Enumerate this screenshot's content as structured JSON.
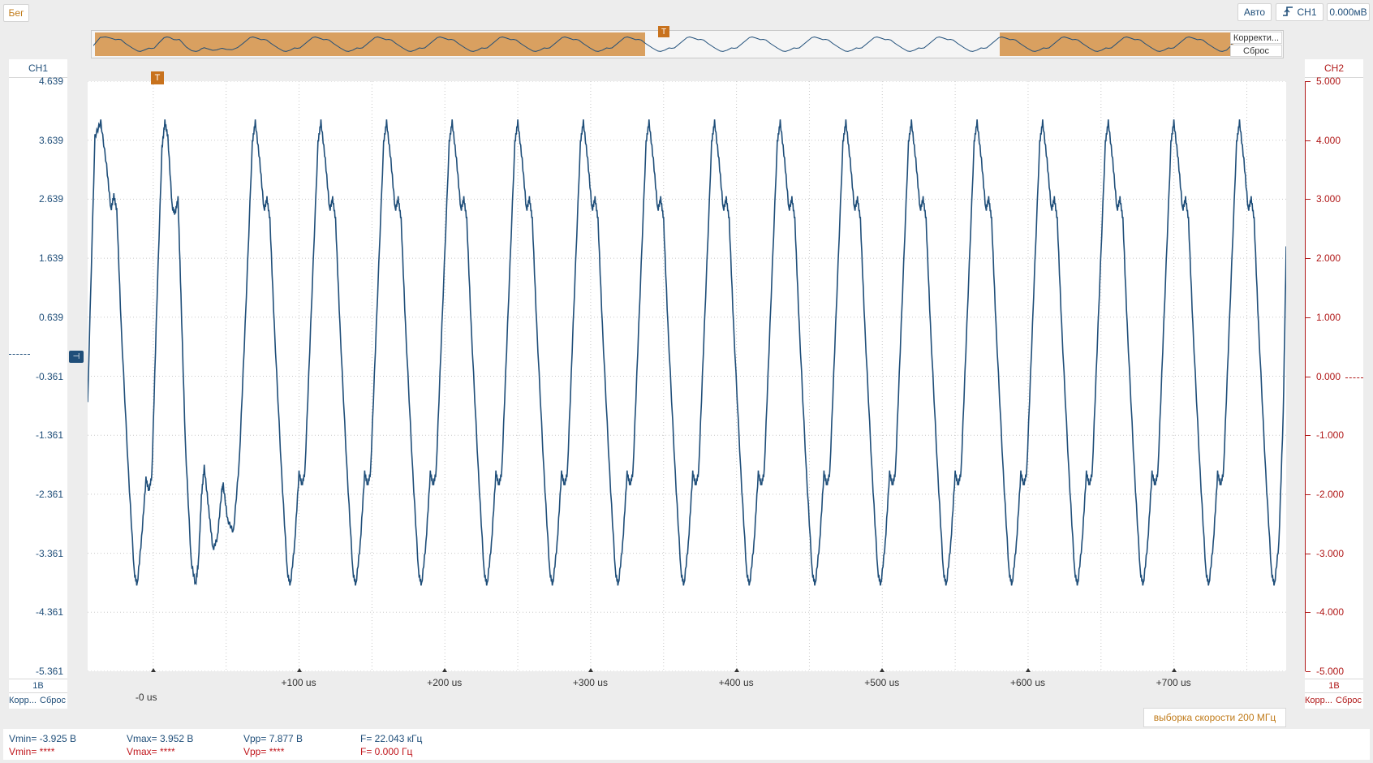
{
  "toolbar": {
    "run_label": "Бег",
    "auto_label": "Авто",
    "trigger_channel": "CH1",
    "trigger_level": "0.000мВ"
  },
  "overview": {
    "correction_label": "Корректи...",
    "reset_label": "Сброс",
    "trigger_marker": "T"
  },
  "ch1": {
    "name": "CH1",
    "ticks": [
      "4.639",
      "3.639",
      "2.639",
      "1.639",
      "0.639",
      "-0.361",
      "-1.361",
      "-2.361",
      "-3.361",
      "-4.361",
      "-5.361"
    ],
    "scale": "1В",
    "corr_label": "Корр...",
    "reset_label": "Сброс",
    "color": "#1f4e79"
  },
  "ch2": {
    "name": "CH2",
    "ticks": [
      "5.000",
      "4.000",
      "3.000",
      "2.000",
      "1.000",
      "0.000",
      "-1.000",
      "-2.000",
      "-3.000",
      "-4.000",
      "-5.000"
    ],
    "scale": "1В",
    "corr_label": "Корр...",
    "reset_label": "Сброс",
    "color": "#b01818"
  },
  "plot": {
    "trigger_marker": "T",
    "x_ticks": [
      "-0 us",
      "+100 us",
      "+200 us",
      "+300 us",
      "+400 us",
      "+500 us",
      "+600 us",
      "+700 us"
    ],
    "sample_rate": "выборка скорости 200 МГц"
  },
  "measurements": {
    "ch1": {
      "vmin": "Vmin= -3.925 В",
      "vmax": "Vmax= 3.952 В",
      "vpp": "Vpp= 7.877 В",
      "freq": "F= 22.043 кГц"
    },
    "ch2": {
      "vmin": "Vmin= ****",
      "vmax": "Vmax= ****",
      "vpp": "Vpp= ****",
      "freq": "F= 0.000 Гц"
    }
  },
  "chart_data": {
    "type": "line",
    "xlabel": "",
    "ylabel": "",
    "x_unit": "us",
    "xlim": [
      -45,
      777
    ],
    "ylim": [
      -5.361,
      4.639
    ],
    "grid": true,
    "series": [
      {
        "name": "CH1",
        "color": "#1f4e79",
        "frequency_khz": 22.043,
        "vmin": -3.925,
        "vmax": 3.952,
        "points": [
          [
            -45,
            -0.8
          ],
          [
            -40,
            3.7
          ],
          [
            -36,
            3.95
          ],
          [
            -32,
            3.2
          ],
          [
            -29,
            2.45
          ],
          [
            -27,
            2.7
          ],
          [
            -25,
            2.45
          ],
          [
            -22,
            0.5
          ],
          [
            -17,
            -2.0
          ],
          [
            -13,
            -3.7
          ],
          [
            -11,
            -3.9
          ],
          [
            -8,
            -3.1
          ],
          [
            -5,
            -2.1
          ],
          [
            -3,
            -2.3
          ],
          [
            -1,
            -2.05
          ],
          [
            2,
            0.5
          ],
          [
            6,
            3.5
          ],
          [
            8,
            3.95
          ],
          [
            10,
            3.7
          ],
          [
            13,
            2.5
          ],
          [
            15,
            2.4
          ],
          [
            17,
            2.65
          ],
          [
            19,
            1.0
          ],
          [
            22,
            -1.5
          ],
          [
            26,
            -3.5
          ],
          [
            29,
            -3.9
          ],
          [
            31,
            -3.5
          ],
          [
            33,
            -2.4
          ],
          [
            35,
            -1.9
          ],
          [
            38,
            -2.6
          ],
          [
            41,
            -3.3
          ],
          [
            44,
            -3.1
          ],
          [
            47,
            -2.3
          ],
          [
            48,
            -2.2
          ],
          [
            51,
            -2.8
          ],
          [
            55,
            -3.0
          ],
          [
            59,
            -1.8
          ],
          [
            63,
            0.5
          ],
          [
            68,
            3.6
          ],
          [
            70,
            3.95
          ],
          [
            73,
            3.3
          ],
          [
            76,
            2.45
          ],
          [
            78,
            2.65
          ],
          [
            80,
            2.3
          ],
          [
            83,
            0.5
          ],
          [
            88,
            -2.0
          ],
          [
            92,
            -3.7
          ],
          [
            94,
            -3.9
          ],
          [
            97,
            -3.2
          ],
          [
            100,
            -2.0
          ],
          [
            102,
            -2.2
          ],
          [
            104,
            -2.0
          ],
          [
            108,
            0.5
          ],
          [
            113,
            3.6
          ],
          [
            115,
            3.95
          ],
          [
            118,
            3.3
          ],
          [
            121,
            2.45
          ],
          [
            123,
            2.65
          ],
          [
            125,
            2.3
          ],
          [
            128,
            0.5
          ],
          [
            133,
            -2.0
          ],
          [
            137,
            -3.7
          ],
          [
            139,
            -3.9
          ],
          [
            142,
            -3.2
          ],
          [
            145,
            -2.0
          ],
          [
            147,
            -2.2
          ],
          [
            149,
            -2.0
          ],
          [
            153,
            0.5
          ],
          [
            158,
            3.6
          ],
          [
            160,
            3.95
          ],
          [
            163,
            3.3
          ],
          [
            166,
            2.45
          ],
          [
            168,
            2.65
          ],
          [
            170,
            2.3
          ],
          [
            173,
            0.5
          ],
          [
            178,
            -2.0
          ],
          [
            182,
            -3.7
          ],
          [
            184,
            -3.9
          ],
          [
            187,
            -3.2
          ],
          [
            190,
            -2.0
          ],
          [
            192,
            -2.2
          ],
          [
            194,
            -2.0
          ],
          [
            198,
            0.5
          ],
          [
            203,
            3.6
          ],
          [
            205,
            3.95
          ],
          [
            208,
            3.3
          ],
          [
            211,
            2.45
          ],
          [
            213,
            2.65
          ],
          [
            215,
            2.3
          ],
          [
            218,
            0.5
          ],
          [
            223,
            -2.0
          ],
          [
            227,
            -3.7
          ],
          [
            229,
            -3.9
          ],
          [
            232,
            -3.2
          ],
          [
            235,
            -2.0
          ],
          [
            237,
            -2.2
          ],
          [
            239,
            -2.0
          ],
          [
            243,
            0.5
          ],
          [
            248,
            3.6
          ],
          [
            250,
            3.95
          ],
          [
            253,
            3.3
          ],
          [
            256,
            2.45
          ],
          [
            258,
            2.65
          ],
          [
            260,
            2.3
          ],
          [
            263,
            0.5
          ],
          [
            268,
            -2.0
          ],
          [
            272,
            -3.7
          ],
          [
            274,
            -3.9
          ],
          [
            277,
            -3.2
          ],
          [
            280,
            -2.0
          ],
          [
            282,
            -2.2
          ],
          [
            284,
            -2.0
          ],
          [
            288,
            0.5
          ],
          [
            293,
            3.6
          ],
          [
            295,
            3.95
          ],
          [
            298,
            3.3
          ],
          [
            301,
            2.45
          ],
          [
            303,
            2.65
          ],
          [
            305,
            2.3
          ],
          [
            308,
            0.5
          ],
          [
            313,
            -2.0
          ],
          [
            317,
            -3.7
          ],
          [
            319,
            -3.9
          ],
          [
            322,
            -3.2
          ],
          [
            325,
            -2.0
          ],
          [
            327,
            -2.2
          ],
          [
            329,
            -2.0
          ],
          [
            333,
            0.5
          ],
          [
            338,
            3.6
          ],
          [
            340,
            3.95
          ],
          [
            343,
            3.3
          ],
          [
            346,
            2.45
          ],
          [
            348,
            2.65
          ],
          [
            350,
            2.3
          ],
          [
            353,
            0.5
          ],
          [
            358,
            -2.0
          ],
          [
            362,
            -3.7
          ],
          [
            364,
            -3.9
          ],
          [
            367,
            -3.2
          ],
          [
            370,
            -2.0
          ],
          [
            372,
            -2.2
          ],
          [
            374,
            -2.0
          ],
          [
            378,
            0.5
          ],
          [
            383,
            3.6
          ],
          [
            385,
            3.95
          ],
          [
            388,
            3.3
          ],
          [
            391,
            2.45
          ],
          [
            393,
            2.65
          ],
          [
            395,
            2.3
          ],
          [
            398,
            0.5
          ],
          [
            403,
            -2.0
          ],
          [
            407,
            -3.7
          ],
          [
            409,
            -3.9
          ],
          [
            412,
            -3.2
          ],
          [
            415,
            -2.0
          ],
          [
            417,
            -2.2
          ],
          [
            419,
            -2.0
          ],
          [
            423,
            0.5
          ],
          [
            428,
            3.6
          ],
          [
            430,
            3.95
          ],
          [
            433,
            3.3
          ],
          [
            436,
            2.45
          ],
          [
            438,
            2.65
          ],
          [
            440,
            2.3
          ],
          [
            443,
            0.5
          ],
          [
            448,
            -2.0
          ],
          [
            452,
            -3.7
          ],
          [
            454,
            -3.9
          ],
          [
            457,
            -3.2
          ],
          [
            460,
            -2.0
          ],
          [
            462,
            -2.2
          ],
          [
            464,
            -2.0
          ],
          [
            468,
            0.5
          ],
          [
            473,
            3.6
          ],
          [
            475,
            3.95
          ],
          [
            478,
            3.3
          ],
          [
            481,
            2.45
          ],
          [
            483,
            2.65
          ],
          [
            485,
            2.3
          ],
          [
            488,
            0.5
          ],
          [
            493,
            -2.0
          ],
          [
            497,
            -3.7
          ],
          [
            499,
            -3.9
          ],
          [
            502,
            -3.2
          ],
          [
            505,
            -2.0
          ],
          [
            507,
            -2.2
          ],
          [
            509,
            -2.0
          ],
          [
            513,
            0.5
          ],
          [
            518,
            3.6
          ],
          [
            520,
            3.95
          ],
          [
            523,
            3.3
          ],
          [
            526,
            2.45
          ],
          [
            528,
            2.65
          ],
          [
            530,
            2.3
          ],
          [
            533,
            0.5
          ],
          [
            538,
            -2.0
          ],
          [
            542,
            -3.7
          ],
          [
            544,
            -3.9
          ],
          [
            547,
            -3.2
          ],
          [
            550,
            -2.0
          ],
          [
            552,
            -2.2
          ],
          [
            554,
            -2.0
          ],
          [
            558,
            0.5
          ],
          [
            563,
            3.6
          ],
          [
            565,
            3.95
          ],
          [
            568,
            3.3
          ],
          [
            571,
            2.45
          ],
          [
            573,
            2.65
          ],
          [
            575,
            2.3
          ],
          [
            578,
            0.5
          ],
          [
            583,
            -2.0
          ],
          [
            587,
            -3.7
          ],
          [
            589,
            -3.9
          ],
          [
            592,
            -3.2
          ],
          [
            595,
            -2.0
          ],
          [
            597,
            -2.2
          ],
          [
            599,
            -2.0
          ],
          [
            603,
            0.5
          ],
          [
            608,
            3.6
          ],
          [
            610,
            3.95
          ],
          [
            613,
            3.3
          ],
          [
            616,
            2.45
          ],
          [
            618,
            2.65
          ],
          [
            620,
            2.3
          ],
          [
            623,
            0.5
          ],
          [
            628,
            -2.0
          ],
          [
            632,
            -3.7
          ],
          [
            634,
            -3.9
          ],
          [
            637,
            -3.2
          ],
          [
            640,
            -2.0
          ],
          [
            642,
            -2.2
          ],
          [
            644,
            -2.0
          ],
          [
            648,
            0.5
          ],
          [
            653,
            3.6
          ],
          [
            655,
            3.95
          ],
          [
            658,
            3.3
          ],
          [
            661,
            2.45
          ],
          [
            663,
            2.65
          ],
          [
            665,
            2.3
          ],
          [
            668,
            0.5
          ],
          [
            673,
            -2.0
          ],
          [
            677,
            -3.7
          ],
          [
            679,
            -3.9
          ],
          [
            682,
            -3.2
          ],
          [
            685,
            -2.0
          ],
          [
            687,
            -2.2
          ],
          [
            689,
            -2.0
          ],
          [
            693,
            0.5
          ],
          [
            698,
            3.6
          ],
          [
            700,
            3.95
          ],
          [
            703,
            3.3
          ],
          [
            706,
            2.45
          ],
          [
            708,
            2.65
          ],
          [
            710,
            2.3
          ],
          [
            713,
            0.5
          ],
          [
            718,
            -2.0
          ],
          [
            722,
            -3.7
          ],
          [
            724,
            -3.9
          ],
          [
            727,
            -3.2
          ],
          [
            730,
            -2.0
          ],
          [
            732,
            -2.2
          ],
          [
            734,
            -2.0
          ],
          [
            738,
            0.5
          ],
          [
            743,
            3.6
          ],
          [
            745,
            3.95
          ],
          [
            748,
            3.3
          ],
          [
            751,
            2.45
          ],
          [
            753,
            2.65
          ],
          [
            755,
            2.3
          ],
          [
            758,
            0.5
          ],
          [
            763,
            -2.0
          ],
          [
            767,
            -3.7
          ],
          [
            769,
            -3.9
          ],
          [
            772,
            -3.2
          ],
          [
            775,
            -1.0
          ],
          [
            777,
            1.8
          ]
        ]
      }
    ]
  }
}
